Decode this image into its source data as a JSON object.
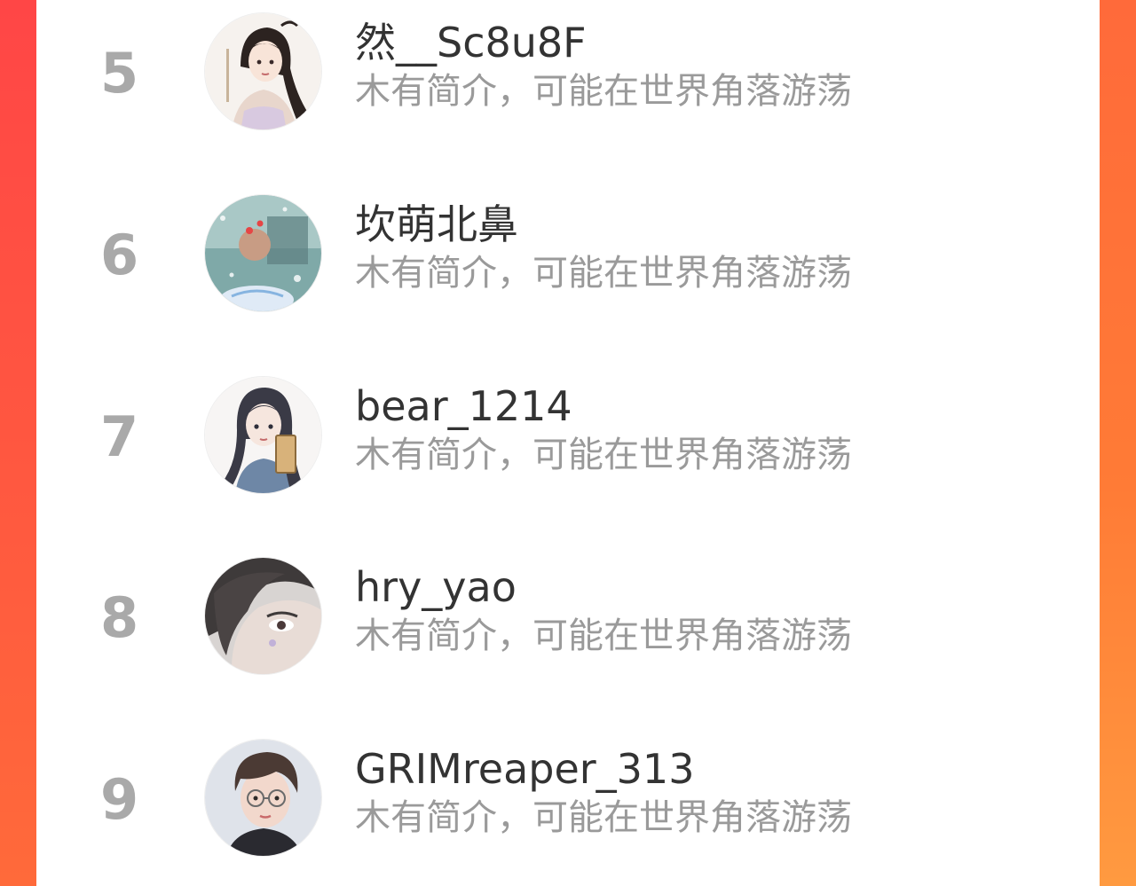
{
  "leaderboard": {
    "rows": [
      {
        "rank": "5",
        "name": "然__Sc8u8F",
        "bio": "木有简介，可能在世界角落游荡",
        "avatar_icon": "girl-hanfu-avatar"
      },
      {
        "rank": "6",
        "name": "坎萌北鼻",
        "bio": "木有简介，可能在世界角落游荡",
        "avatar_icon": "bubble-scene-avatar"
      },
      {
        "rank": "7",
        "name": "bear_1214",
        "bio": "木有简介，可能在世界角落游荡",
        "avatar_icon": "girl-long-hair-avatar"
      },
      {
        "rank": "8",
        "name": "hry_yao",
        "bio": "木有简介，可能在世界角落游荡",
        "avatar_icon": "face-closeup-avatar"
      },
      {
        "rank": "9",
        "name": "GRIMreaper_313",
        "bio": "木有简介，可能在世界角落游荡",
        "avatar_icon": "boy-glasses-avatar"
      }
    ]
  },
  "colors": {
    "frame_top": "#ff4646",
    "frame_bottom": "#ff9a40",
    "rank_text": "#a9a9a9",
    "name_text": "#333333",
    "bio_text": "#9a9a9a"
  }
}
